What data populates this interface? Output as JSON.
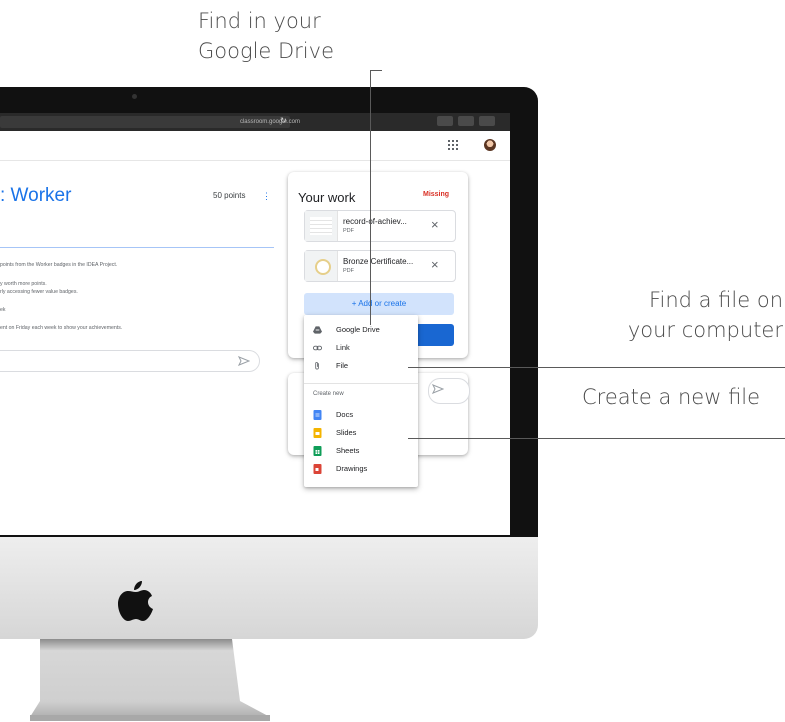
{
  "callouts": {
    "drive_line1": "Find in your",
    "drive_line2": "Google Drive",
    "computer_line1": "Find a file on",
    "computer_line2": "your computer",
    "create": "Create a new file"
  },
  "browser": {
    "url": "classroom.google.com"
  },
  "assignment": {
    "title": ": Worker",
    "points": "50 points",
    "description_lines": [
      "points from the Worker badges in the IDEA Project.",
      "y worth more points.",
      "rly accessing fewer value badges.",
      "ek",
      "ent on Friday each week to show your achievements."
    ]
  },
  "your_work": {
    "title": "Your work",
    "status": "Missing",
    "files": [
      {
        "name": "record-of-achiev...",
        "type": "PDF"
      },
      {
        "name": "Bronze Certificate...",
        "type": "PDF"
      }
    ],
    "add_create_label": "+ Add or create"
  },
  "menu": {
    "items": [
      {
        "label": "Google Drive",
        "icon": "google-drive-icon"
      },
      {
        "label": "Link",
        "icon": "link-icon"
      },
      {
        "label": "File",
        "icon": "paperclip-icon"
      }
    ],
    "section_label": "Create new",
    "create_items": [
      {
        "label": "Docs",
        "icon": "docs-icon",
        "color": "#4285f4"
      },
      {
        "label": "Slides",
        "icon": "slides-icon",
        "color": "#f4b400"
      },
      {
        "label": "Sheets",
        "icon": "sheets-icon",
        "color": "#0f9d58"
      },
      {
        "label": "Drawings",
        "icon": "drawings-icon",
        "color": "#db4437"
      }
    ]
  },
  "colors": {
    "accent": "#1a73e8",
    "missing": "#d93025",
    "add_create_bg": "#d2e3fc",
    "submit_bg": "#1967d2"
  }
}
